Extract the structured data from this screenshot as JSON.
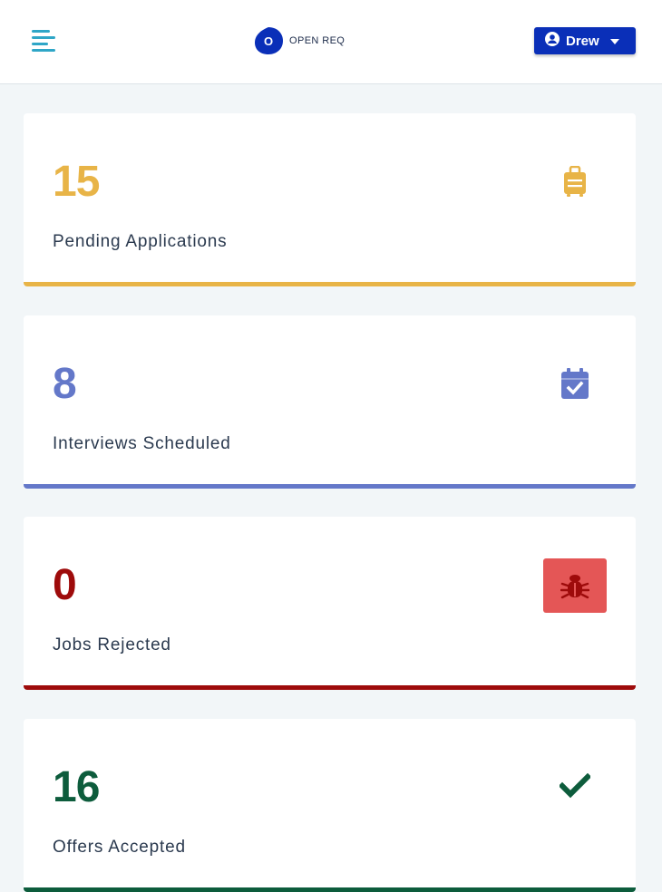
{
  "header": {
    "menu_icon": "hamburger-menu-icon",
    "logo_text": "OPEN REQ",
    "logo_letter": "O",
    "user_icon": "user-circle-icon",
    "user_name": "Drew",
    "caret_icon": "caret-down-icon",
    "colors": {
      "menu": "#2fa6c7",
      "logo": "#0a2fb8",
      "user_button": "#0a2fb8"
    }
  },
  "cards": [
    {
      "count": "15",
      "label": "Pending Applications",
      "icon": "suitcase-icon",
      "color": "#e8b447"
    },
    {
      "count": "8",
      "label": "Interviews Scheduled",
      "icon": "calendar-check-icon",
      "color": "#6478c9"
    },
    {
      "count": "0",
      "label": "Jobs Rejected",
      "icon": "bug-icon",
      "color": "#9e0b0b",
      "icon_background": "#e45656"
    },
    {
      "count": "16",
      "label": "Offers Accepted",
      "icon": "check-icon",
      "color": "#0d5c3c"
    }
  ]
}
